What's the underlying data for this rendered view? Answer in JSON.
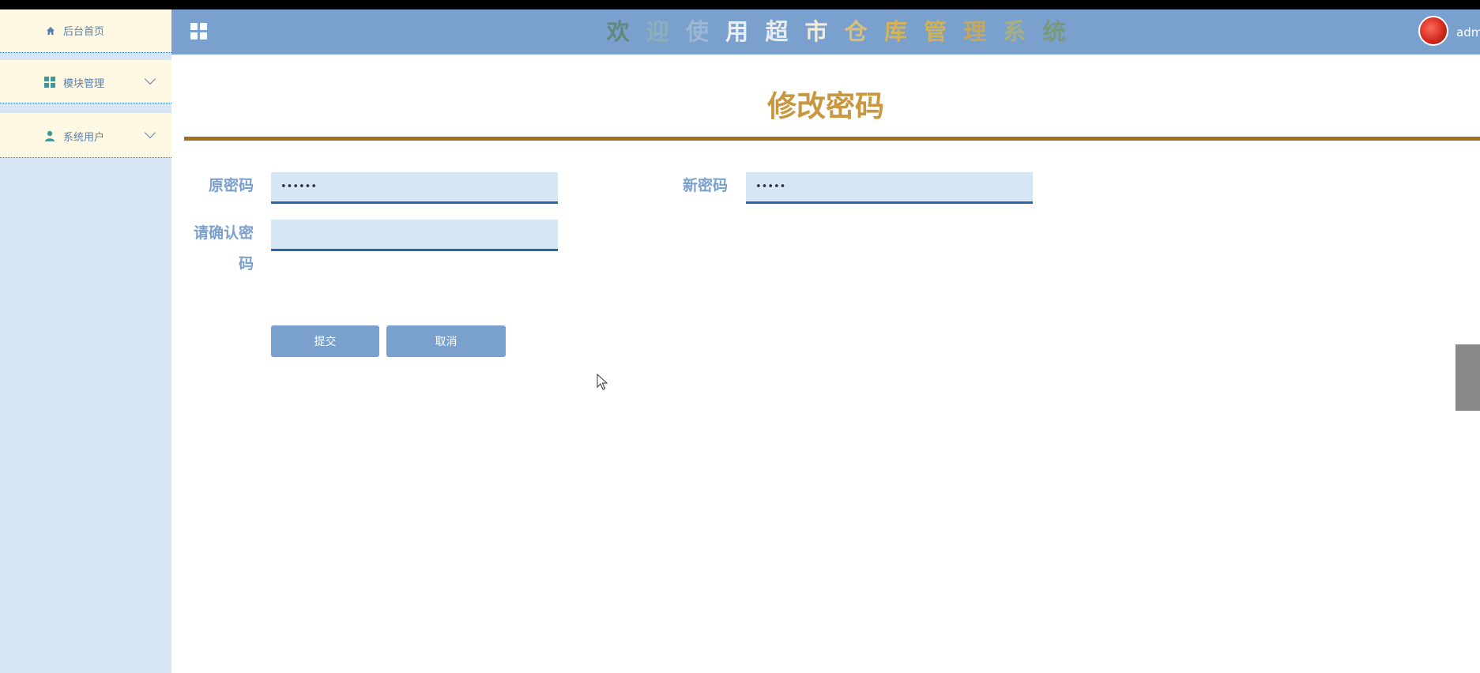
{
  "sidebar": {
    "items": [
      {
        "label": "后台首页",
        "icon": "home-icon"
      },
      {
        "label": "模块管理",
        "icon": "grid-icon"
      },
      {
        "label": "系统用户",
        "icon": "user-icon"
      }
    ]
  },
  "header": {
    "title_chars": [
      "欢",
      "迎",
      "使",
      "用",
      "超",
      "市",
      "仓",
      "库",
      "管",
      "理",
      "系",
      "统"
    ],
    "title_colors": [
      "#5e8a7e",
      "#8ab0b8",
      "#9ab8d4",
      "#e8eef4",
      "#e6ecf2",
      "#f4ecd8",
      "#d8c07a",
      "#d4b45a",
      "#d8b048",
      "#c8a858",
      "#a8b080",
      "#789a78"
    ],
    "user": "admin"
  },
  "main": {
    "page_title": "修改密码",
    "fields": {
      "old_password": {
        "label": "原密码",
        "value": "••••••"
      },
      "new_password": {
        "label": "新密码",
        "value": "•••••"
      },
      "confirm_password": {
        "label_line1": "请确认密",
        "label_line2": "码",
        "value": ""
      }
    },
    "buttons": {
      "submit": "提交",
      "cancel": "取消"
    }
  },
  "colors": {
    "header_bg": "#7aa0cd",
    "sidebar_bg": "#d6e6f5",
    "sidebar_item_bg": "#fff9e3",
    "title_gold": "#c8973f",
    "divider": "#a07020",
    "button_bg": "#7aa0cd",
    "input_bg": "#d6e6f5"
  }
}
